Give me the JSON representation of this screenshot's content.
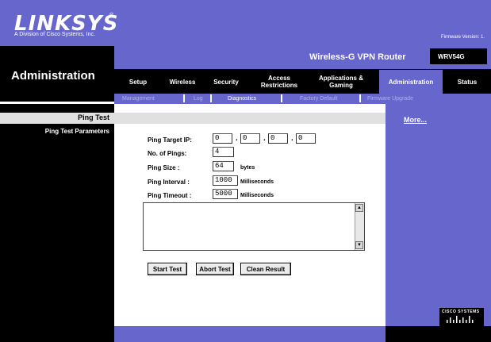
{
  "header": {
    "logo": "LINKSYS",
    "logo_mark": "®",
    "logo_subtitle": "A Division of Cisco Systems, Inc.",
    "firmware_label": "Firmware Version: 1."
  },
  "banner": {
    "section_title": "Administration",
    "product_name": "Wireless-G VPN Router",
    "model": "WRV54G"
  },
  "tabs": [
    {
      "label": "Setup"
    },
    {
      "label": "Wireless"
    },
    {
      "label": "Security"
    },
    {
      "label": "Access Restrictions"
    },
    {
      "label": "Applications & Gaming"
    },
    {
      "label": "Administration"
    },
    {
      "label": "Status"
    }
  ],
  "subtabs": [
    {
      "label": "Management"
    },
    {
      "label": "Log"
    },
    {
      "label": "Diagnostics"
    },
    {
      "label": "Factory Default"
    },
    {
      "label": "Firmware Upgrade"
    }
  ],
  "left": {
    "section": "Ping Test",
    "params": "Ping Test Parameters"
  },
  "form": {
    "target_ip_label": "Ping Target IP:",
    "ip": [
      "0",
      "0",
      "0",
      "0"
    ],
    "ip_dot": ".",
    "num_pings_label": "No. of Pings:",
    "num_pings": "4",
    "size_label": "Ping Size :",
    "size": "64",
    "size_unit": "bytes",
    "interval_label": "Ping Interval :",
    "interval": "1000",
    "interval_unit": "Milliseconds",
    "timeout_label": "Ping Timeout :",
    "timeout": "5000",
    "timeout_unit": "Milliseconds",
    "result": ""
  },
  "buttons": {
    "start": "Start Test",
    "abort": "Abort Test",
    "clean": "Clean Result"
  },
  "right": {
    "more": "More...",
    "cisco": "CISCO SYSTEMS"
  },
  "colors": {
    "accent": "#6666cc",
    "black": "#000000",
    "grey_bar": "#e0e0e0"
  }
}
